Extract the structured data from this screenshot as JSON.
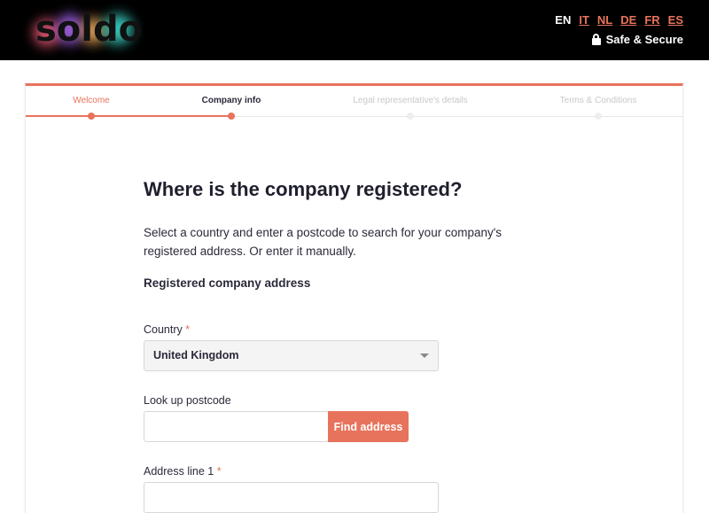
{
  "header": {
    "logo_text": "soldo",
    "languages": [
      "EN",
      "IT",
      "NL",
      "DE",
      "FR",
      "ES"
    ],
    "active_language": "EN",
    "secure_label": "Safe & Secure"
  },
  "steps": [
    {
      "label": "Welcome",
      "state": "done"
    },
    {
      "label": "Company info",
      "state": "current"
    },
    {
      "label": "Legal representative's details",
      "state": "todo"
    },
    {
      "label": "Terms & Conditions",
      "state": "todo"
    }
  ],
  "main": {
    "title": "Where is the company registered?",
    "description": "Select a country and enter a postcode to search for your company's registered address. Or enter it manually.",
    "section_title": "Registered company address"
  },
  "form": {
    "country_label": "Country",
    "required_mark": "*",
    "country_value": "United Kingdom",
    "postcode_label": "Look up postcode",
    "postcode_value": "",
    "find_button": "Find address",
    "address1_label": "Address line 1",
    "address1_value": ""
  },
  "colors": {
    "accent": "#e8735c",
    "header_bg": "#000000"
  }
}
